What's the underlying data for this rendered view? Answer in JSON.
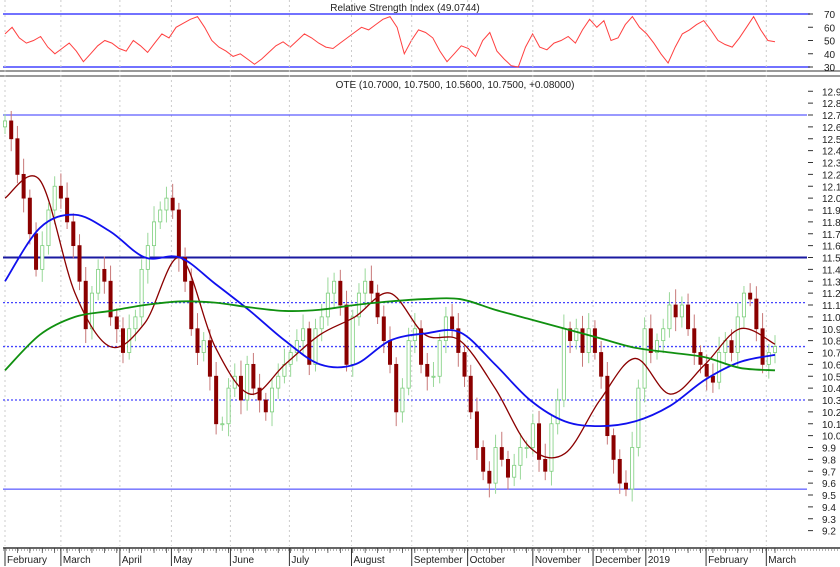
{
  "chart_data": {
    "type": "candlestick",
    "rsi_panel": {
      "title": "Relative Strength Index (49.0744)",
      "ylim": [
        25,
        75
      ],
      "ticks": [
        70,
        60,
        50,
        40,
        30
      ],
      "bands": [
        70,
        30
      ],
      "line_color": "#ff4040",
      "band_color": "#4444ff",
      "values": [
        55,
        60,
        52,
        48,
        50,
        53,
        45,
        40,
        44,
        48,
        42,
        34,
        40,
        46,
        50,
        48,
        44,
        42,
        50,
        46,
        41,
        48,
        55,
        52,
        60,
        63,
        66,
        68,
        60,
        50,
        45,
        42,
        38,
        40,
        36,
        32,
        36,
        41,
        46,
        49,
        45,
        50,
        55,
        52,
        48,
        45,
        44,
        48,
        52,
        56,
        60,
        58,
        62,
        66,
        68,
        60,
        40,
        50,
        58,
        56,
        52,
        42,
        34,
        40,
        46,
        44,
        38,
        50,
        56,
        42,
        36,
        31,
        30,
        45,
        55,
        45,
        43,
        48,
        50,
        53,
        48,
        58,
        66,
        60,
        65,
        50,
        52,
        62,
        68,
        60,
        55,
        48,
        40,
        33,
        45,
        55,
        58,
        62,
        65,
        58,
        50,
        47,
        45,
        52,
        60,
        68,
        58,
        50,
        49
      ]
    },
    "price_panel": {
      "title": "OTE (10.7000, 10.7500, 10.5600, 10.7500, +0.08000)",
      "ylim": [
        9.1,
        12.95
      ],
      "ticks": [
        12.9,
        12.8,
        12.7,
        12.6,
        12.5,
        12.4,
        12.3,
        12.2,
        12.1,
        12.0,
        11.9,
        11.8,
        11.7,
        11.6,
        11.5,
        11.4,
        11.3,
        11.2,
        11.1,
        11.0,
        10.9,
        10.8,
        10.7,
        10.6,
        10.5,
        10.4,
        10.3,
        10.2,
        10.1,
        10.0,
        9.9,
        9.8,
        9.7,
        9.6,
        9.5,
        9.4,
        9.3,
        9.2
      ],
      "closes": [
        12.65,
        12.5,
        12.2,
        12.0,
        11.7,
        11.4,
        11.6,
        11.9,
        12.1,
        12.0,
        11.8,
        11.6,
        11.3,
        10.9,
        11.2,
        11.4,
        11.3,
        11.0,
        10.9,
        10.7,
        10.9,
        11.0,
        11.4,
        11.6,
        11.8,
        11.9,
        12.0,
        11.9,
        11.5,
        11.3,
        10.9,
        10.7,
        10.8,
        10.5,
        10.1,
        10.1,
        10.4,
        10.5,
        10.3,
        10.6,
        10.4,
        10.3,
        10.2,
        10.4,
        10.5,
        10.6,
        10.7,
        10.8,
        10.9,
        10.6,
        10.9,
        11.0,
        11.2,
        11.3,
        11.1,
        10.6,
        11.0,
        11.2,
        11.3,
        11.2,
        11.0,
        10.8,
        10.6,
        10.2,
        10.4,
        10.8,
        10.9,
        10.6,
        10.5,
        10.5,
        10.8,
        11.0,
        10.9,
        10.7,
        10.5,
        10.2,
        9.9,
        9.7,
        9.6,
        9.9,
        9.8,
        9.65,
        9.75,
        9.9,
        9.9,
        10.1,
        9.8,
        9.7,
        10.1,
        10.3,
        10.9,
        10.8,
        10.9,
        10.7,
        10.9,
        10.7,
        10.5,
        10.0,
        9.8,
        9.6,
        9.55,
        9.9,
        10.4,
        10.9,
        10.7,
        10.8,
        10.9,
        11.1,
        11.0,
        11.1,
        10.9,
        10.7,
        10.6,
        10.5,
        10.45,
        10.7,
        10.8,
        10.7,
        11.0,
        11.2,
        11.15,
        10.9,
        10.6,
        10.7,
        10.75
      ],
      "up_color": "#7ccf7c",
      "down_color": "#8b0000",
      "levels": [
        {
          "value": 12.7,
          "style": "solid",
          "color": "#3333ff"
        },
        {
          "value": 11.5,
          "style": "solid-thick",
          "color": "#1a1aa0"
        },
        {
          "value": 11.12,
          "style": "dotted",
          "color": "#4444ff"
        },
        {
          "value": 10.75,
          "style": "dotted",
          "color": "#4444ff"
        },
        {
          "value": 10.3,
          "style": "dotted",
          "color": "#4444ff"
        },
        {
          "value": 9.55,
          "style": "solid",
          "color": "#3333ff"
        }
      ],
      "moving_averages": [
        {
          "name": "short MA",
          "color": "#8b0000",
          "values": [
            12.0,
            12.15,
            11.2,
            10.75,
            10.95,
            11.5,
            10.75,
            10.35,
            10.6,
            10.85,
            11.0,
            11.2,
            10.85,
            10.8,
            10.4,
            9.9,
            9.85,
            10.3,
            10.65,
            10.35,
            10.6,
            10.9,
            10.77
          ]
        },
        {
          "name": "medium MA",
          "color": "#1010ee",
          "values": [
            11.3,
            11.75,
            11.86,
            11.72,
            11.5,
            11.5,
            11.28,
            11.05,
            10.8,
            10.6,
            10.6,
            10.8,
            10.86,
            10.87,
            10.6,
            10.3,
            10.12,
            10.08,
            10.12,
            10.25,
            10.47,
            10.62,
            10.68
          ]
        },
        {
          "name": "long MA",
          "color": "#109010",
          "values": [
            10.55,
            10.85,
            11.0,
            11.05,
            11.1,
            11.13,
            11.12,
            11.08,
            11.05,
            11.06,
            11.1,
            11.13,
            11.15,
            11.15,
            11.06,
            10.98,
            10.9,
            10.82,
            10.74,
            10.7,
            10.66,
            10.57,
            10.55
          ]
        }
      ]
    },
    "x_axis": {
      "months": [
        {
          "label": "February",
          "bar": 0
        },
        {
          "label": "March",
          "bar": 9
        },
        {
          "label": "April",
          "bar": 18.5
        },
        {
          "label": "May",
          "bar": 26.8
        },
        {
          "label": "June",
          "bar": 36.3
        },
        {
          "label": "July",
          "bar": 45.8
        },
        {
          "label": "August",
          "bar": 55.8
        },
        {
          "label": "September",
          "bar": 65.5
        },
        {
          "label": "October",
          "bar": 74.5
        },
        {
          "label": "November",
          "bar": 85
        },
        {
          "label": "December",
          "bar": 94.7
        },
        {
          "label": "2019",
          "bar": 103.2
        },
        {
          "label": "February",
          "bar": 112.9
        },
        {
          "label": "March",
          "bar": 122.6
        }
      ]
    }
  }
}
